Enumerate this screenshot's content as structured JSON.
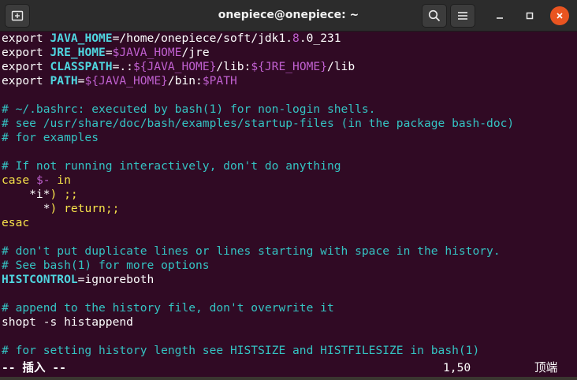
{
  "window": {
    "title": "onepiece@onepiece: ~"
  },
  "titlebar": {
    "icons": {
      "new_tab": "new-tab-icon",
      "search": "search-icon",
      "menu": "hamburger-menu-icon",
      "minimize": "minimize-icon",
      "maximize": "maximize-icon",
      "close": "close-icon"
    }
  },
  "editor": {
    "lines": [
      {
        "segments": [
          {
            "t": "export ",
            "c": "sx"
          },
          {
            "t": "JAVA_HOME",
            "c": "vr"
          },
          {
            "t": "=/home/onepiece/soft/jdk1.",
            "c": "sx"
          },
          {
            "t": "8",
            "c": "pv"
          },
          {
            "t": ".0_231",
            "c": "sx"
          }
        ]
      },
      {
        "segments": [
          {
            "t": "export ",
            "c": "sx"
          },
          {
            "t": "JRE_HOME",
            "c": "vr"
          },
          {
            "t": "=",
            "c": "sx"
          },
          {
            "t": "$JAVA_HOME",
            "c": "pv"
          },
          {
            "t": "/jre",
            "c": "sx"
          }
        ]
      },
      {
        "segments": [
          {
            "t": "export ",
            "c": "sx"
          },
          {
            "t": "CLASSPATH",
            "c": "vr"
          },
          {
            "t": "=.:",
            "c": "sx"
          },
          {
            "t": "${JAVA_HOME}",
            "c": "pv"
          },
          {
            "t": "/lib:",
            "c": "sx"
          },
          {
            "t": "${JRE_HOME}",
            "c": "pv"
          },
          {
            "t": "/lib",
            "c": "sx"
          }
        ]
      },
      {
        "segments": [
          {
            "t": "export ",
            "c": "sx"
          },
          {
            "t": "PATH",
            "c": "vr"
          },
          {
            "t": "=",
            "c": "sx"
          },
          {
            "t": "${JAVA_HOME}",
            "c": "pv"
          },
          {
            "t": "/bin:",
            "c": "sx"
          },
          {
            "t": "$PATH",
            "c": "pv"
          }
        ]
      },
      {
        "segments": []
      },
      {
        "segments": [
          {
            "t": "# ~/.bashrc: executed by bash(1) for non-login shells.",
            "c": "cm"
          }
        ]
      },
      {
        "segments": [
          {
            "t": "# see /usr/share/doc/bash/examples/startup-files (in the package bash-doc)",
            "c": "cm"
          }
        ]
      },
      {
        "segments": [
          {
            "t": "# for examples",
            "c": "cm"
          }
        ]
      },
      {
        "segments": []
      },
      {
        "segments": [
          {
            "t": "# If not running interactively, don't do anything",
            "c": "cm"
          }
        ]
      },
      {
        "segments": [
          {
            "t": "case ",
            "c": "ky"
          },
          {
            "t": "$-",
            "c": "pv"
          },
          {
            "t": " in",
            "c": "ky"
          }
        ]
      },
      {
        "segments": [
          {
            "t": "    *i*",
            "c": "sx"
          },
          {
            "t": ") ;;",
            "c": "ky"
          }
        ]
      },
      {
        "segments": [
          {
            "t": "      *",
            "c": "sx"
          },
          {
            "t": ") ",
            "c": "ky"
          },
          {
            "t": "return",
            "c": "ky"
          },
          {
            "t": ";;",
            "c": "ky"
          }
        ]
      },
      {
        "segments": [
          {
            "t": "esac",
            "c": "ky"
          }
        ]
      },
      {
        "segments": []
      },
      {
        "segments": [
          {
            "t": "# don't put duplicate lines or lines starting with space in the history.",
            "c": "cm"
          }
        ]
      },
      {
        "segments": [
          {
            "t": "# See bash(1) for more options",
            "c": "cm"
          }
        ]
      },
      {
        "segments": [
          {
            "t": "HISTCONTROL",
            "c": "vr"
          },
          {
            "t": "=ignoreboth",
            "c": "sx"
          }
        ]
      },
      {
        "segments": []
      },
      {
        "segments": [
          {
            "t": "# append to the history file, don't overwrite it",
            "c": "cm"
          }
        ]
      },
      {
        "segments": [
          {
            "t": "shopt -s histappend",
            "c": "sx"
          }
        ]
      },
      {
        "segments": []
      },
      {
        "segments": [
          {
            "t": "# for setting history length see HISTSIZE and HISTFILESIZE in bash(1)",
            "c": "cm"
          }
        ]
      }
    ]
  },
  "statusbar": {
    "mode": "-- 插入 --",
    "cursor": "1,50",
    "scroll": "顶端"
  },
  "colors": {
    "terminal_bg": "#300a24",
    "titlebar_bg": "#2c2c2c",
    "close_button": "#e95420"
  }
}
